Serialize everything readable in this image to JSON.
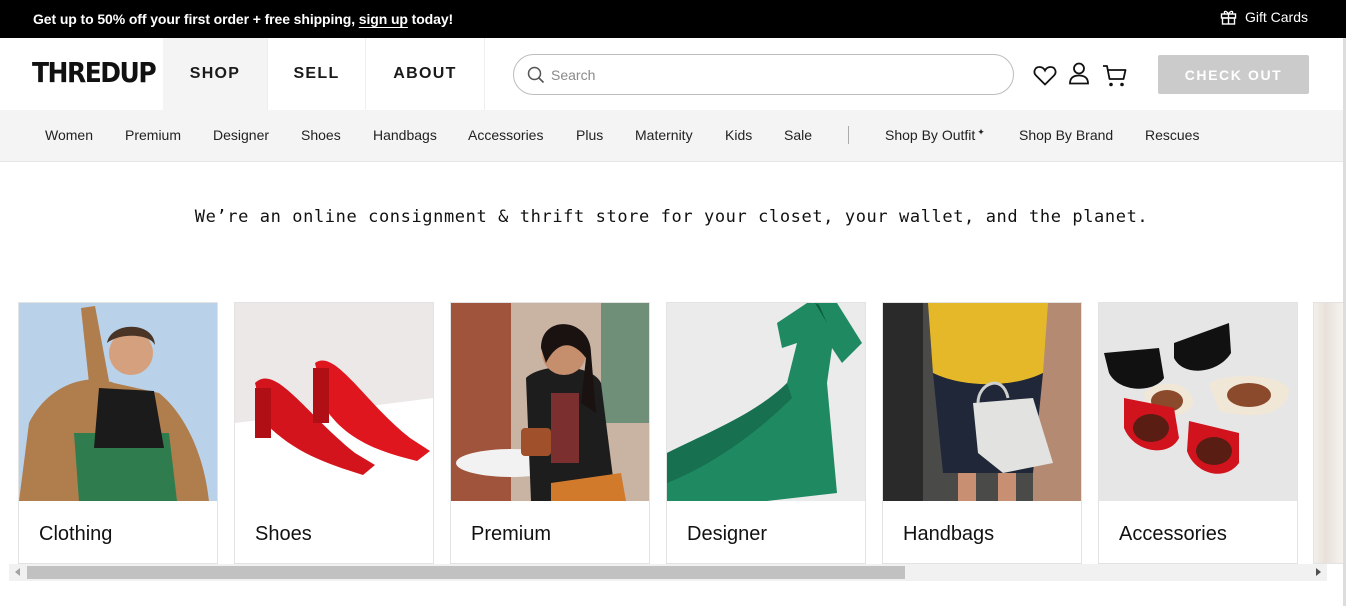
{
  "promo": {
    "text_before": "Get up to 50% off your first order + free shipping, ",
    "link": "sign up",
    "text_after": " today!",
    "gift_cards": "Gift Cards"
  },
  "header": {
    "logo": "THREDUP",
    "nav": [
      "SHOP",
      "SELL",
      "ABOUT"
    ],
    "search_placeholder": "Search",
    "checkout": "CHECK OUT"
  },
  "categories": [
    "Women",
    "Premium",
    "Designer",
    "Shoes",
    "Handbags",
    "Accessories",
    "Plus",
    "Maternity",
    "Kids",
    "Sale",
    "Shop By Outfit",
    "Shop By Brand",
    "Rescues"
  ],
  "tagline": "We’re an online consignment & thrift store for your closet, your wallet, and the planet.",
  "cards": [
    "Clothing",
    "Shoes",
    "Premium",
    "Designer",
    "Handbags",
    "Accessories"
  ],
  "colors": {
    "promo_bg": "#000000",
    "checkout_bg": "#cbcbcb",
    "nav_bg": "#f4f4f4"
  }
}
